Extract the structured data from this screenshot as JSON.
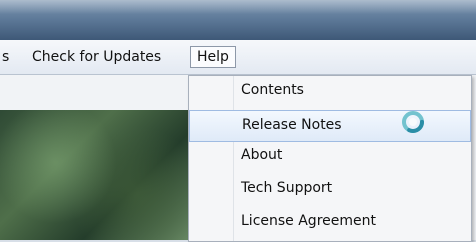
{
  "menubar": {
    "partial_left": "s",
    "check_for_updates": "Check for Updates",
    "help": "Help"
  },
  "help_menu": {
    "items": [
      {
        "label": "Contents"
      },
      {
        "label": "Release Notes",
        "highlighted": true
      },
      {
        "label": "About"
      },
      {
        "label": "Tech Support"
      },
      {
        "label": "License Agreement"
      }
    ]
  },
  "icons": {
    "busy_indicator": "busy-spinner-icon"
  },
  "colors": {
    "title_bar": "#5f7b9a",
    "menu_background": "#f5f6f8",
    "highlight_background": "#dfeaf8",
    "highlight_border": "#9fbbe2"
  }
}
